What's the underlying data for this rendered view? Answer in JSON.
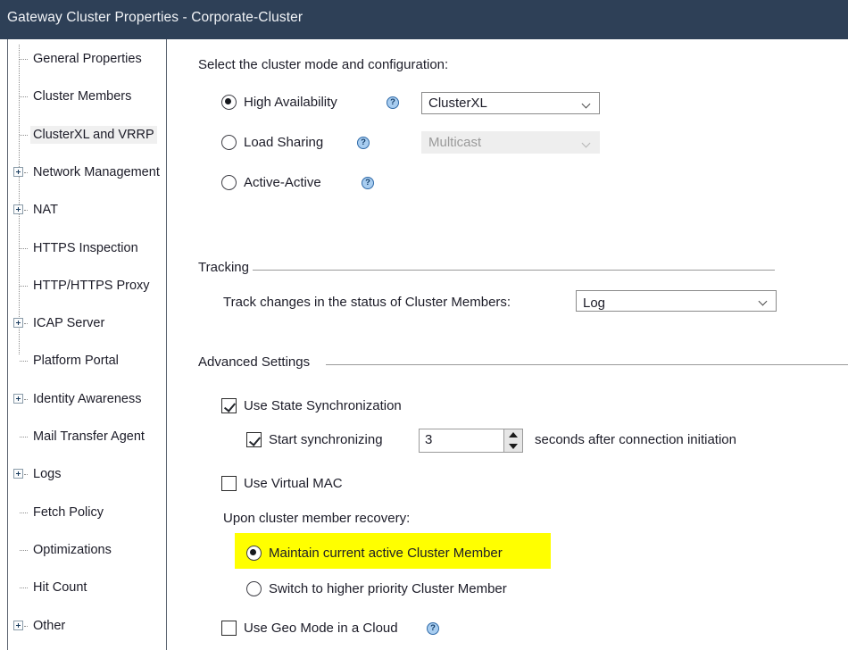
{
  "window": {
    "title": "Gateway Cluster Properties - Corporate-Cluster"
  },
  "sidebar": {
    "items": [
      {
        "label": "General Properties",
        "expandable": false,
        "selected": false
      },
      {
        "label": "Cluster Members",
        "expandable": false,
        "selected": false
      },
      {
        "label": "ClusterXL and VRRP",
        "expandable": false,
        "selected": true
      },
      {
        "label": "Network Management",
        "expandable": true,
        "selected": false
      },
      {
        "label": "NAT",
        "expandable": true,
        "selected": false
      },
      {
        "label": "HTTPS Inspection",
        "expandable": false,
        "selected": false
      },
      {
        "label": "HTTP/HTTPS Proxy",
        "expandable": false,
        "selected": false
      },
      {
        "label": "ICAP Server",
        "expandable": true,
        "selected": false
      },
      {
        "label": "Platform Portal",
        "expandable": false,
        "selected": false
      },
      {
        "label": "Identity Awareness",
        "expandable": true,
        "selected": false
      },
      {
        "label": "Mail Transfer Agent",
        "expandable": false,
        "selected": false
      },
      {
        "label": "Logs",
        "expandable": true,
        "selected": false
      },
      {
        "label": "Fetch Policy",
        "expandable": false,
        "selected": false
      },
      {
        "label": "Optimizations",
        "expandable": false,
        "selected": false
      },
      {
        "label": "Hit Count",
        "expandable": false,
        "selected": false
      },
      {
        "label": "Other",
        "expandable": true,
        "selected": false
      }
    ]
  },
  "main": {
    "intro_label": "Select the cluster mode and configuration:",
    "modes": [
      {
        "label": "High Availability",
        "selected": true,
        "help": "?"
      },
      {
        "label": "Load Sharing",
        "selected": false,
        "help": "?"
      },
      {
        "label": "Active-Active",
        "selected": false,
        "help": "?"
      }
    ],
    "ha_combo": {
      "value": "ClusterXL",
      "enabled": true
    },
    "ls_combo": {
      "value": "Multicast",
      "enabled": false
    },
    "tracking": {
      "group_title": "Tracking",
      "label": "Track changes in the status of Cluster Members:",
      "combo_value": "Log"
    },
    "advanced": {
      "group_title": "Advanced Settings",
      "use_state_sync": {
        "label": "Use State Synchronization",
        "checked": true
      },
      "start_sync": {
        "label": "Start synchronizing",
        "checked": true,
        "value": "3",
        "suffix": "seconds after connection initiation"
      },
      "use_virtual_mac": {
        "label": "Use Virtual MAC",
        "checked": false
      },
      "recovery_label": "Upon cluster member recovery:",
      "recovery_options": [
        {
          "label": "Maintain current active Cluster Member",
          "selected": true,
          "highlighted": true
        },
        {
          "label": "Switch to higher priority Cluster Member",
          "selected": false,
          "highlighted": false
        }
      ],
      "use_geo_mode": {
        "label": "Use Geo Mode in a Cloud",
        "checked": false,
        "help": "?"
      }
    }
  },
  "colors": {
    "titlebar_bg": "#2e4057",
    "highlight": "#ffff00",
    "help_icon_bg": "#a8cdf0",
    "selection_bg": "#f0f0f0"
  }
}
